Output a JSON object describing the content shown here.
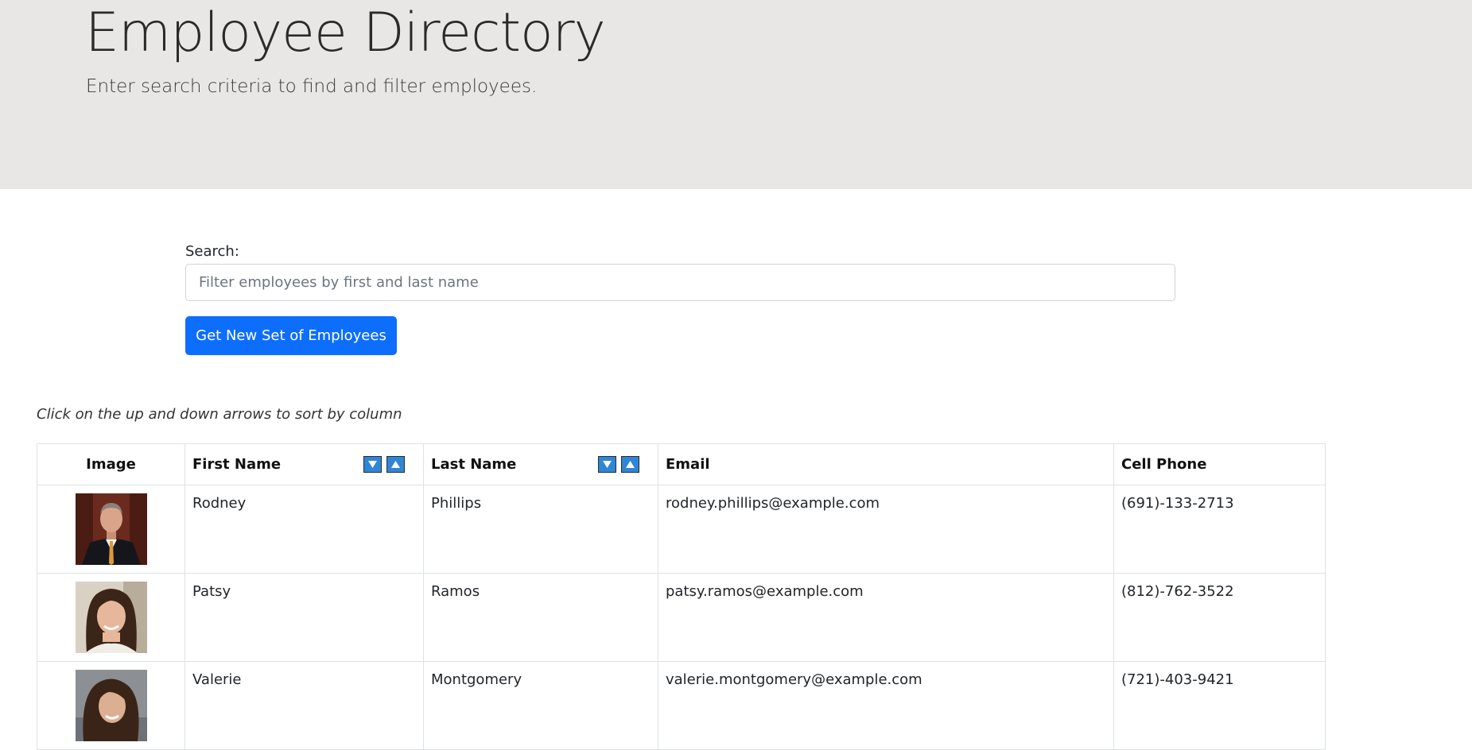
{
  "header": {
    "title": "Employee Directory",
    "subtitle": "Enter search criteria to find and filter employees."
  },
  "search": {
    "label": "Search:",
    "value": "",
    "placeholder": "Filter employees by first and last name"
  },
  "actions": {
    "new_set_label": "Get New Set of Employees"
  },
  "hint": "Click on the up and down arrows to sort by column",
  "colors": {
    "accent": "#0d6efd",
    "sort_button": "#2f86d6",
    "hero_bg": "#e8e7e6"
  },
  "table": {
    "columns": {
      "image": "Image",
      "first_name": "First Name",
      "last_name": "Last Name",
      "email": "Email",
      "cell_phone": "Cell Phone"
    },
    "sort_icons": [
      "sort-descending-icon",
      "sort-ascending-icon"
    ],
    "rows": [
      {
        "first": "Rodney",
        "last": "Phillips",
        "email": "rodney.phillips@example.com",
        "phone": "(691)-133-2713"
      },
      {
        "first": "Patsy",
        "last": "Ramos",
        "email": "patsy.ramos@example.com",
        "phone": "(812)-762-3522"
      },
      {
        "first": "Valerie",
        "last": "Montgomery",
        "email": "valerie.montgomery@example.com",
        "phone": "(721)-403-9421"
      }
    ]
  }
}
